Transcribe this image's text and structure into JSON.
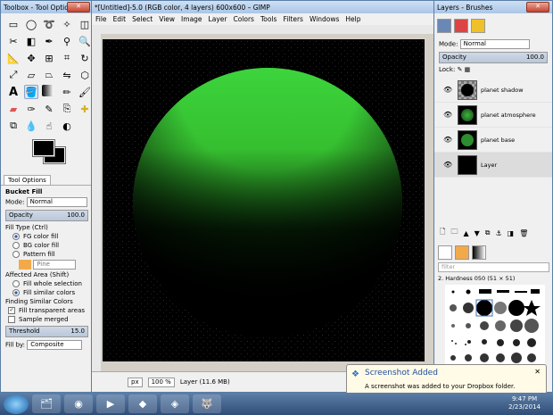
{
  "toolbox": {
    "title": "Toolbox - Tool Options",
    "tab_label": "Tool Options",
    "tool_name": "Bucket Fill",
    "mode_label": "Mode:",
    "mode_value": "Normal",
    "opacity_label": "Opacity",
    "opacity_value": "100.0",
    "fill_type_label": "Fill Type  (Ctrl)",
    "fill_fg": "FG color fill",
    "fill_bg": "BG color fill",
    "fill_pattern": "Pattern fill",
    "pattern_name": "Pine",
    "affected_label": "Affected Area  (Shift)",
    "fill_whole": "Fill whole selection",
    "fill_similar": "Fill similar colors",
    "finding_label": "Finding Similar Colors",
    "fill_transparent": "Fill transparent areas",
    "sample_merged": "Sample merged",
    "threshold_label": "Threshold",
    "threshold_value": "15.0",
    "fill_by_label": "Fill by:",
    "fill_by_value": "Composite"
  },
  "image_window": {
    "title": "*[Untitled]-5.0 (RGB color, 4 layers) 600x600 – GIMP",
    "menu": [
      "File",
      "Edit",
      "Select",
      "View",
      "Image",
      "Layer",
      "Colors",
      "Tools",
      "Filters",
      "Windows",
      "Help"
    ],
    "unit": "px",
    "zoom": "100 %",
    "status": "Layer (11.6 MB)"
  },
  "layers_panel": {
    "title": "Layers - Brushes",
    "mode_label": "Mode:",
    "mode_value": "Normal",
    "opacity_label": "Opacity",
    "opacity_value": "100.0",
    "lock_label": "Lock:",
    "layers": [
      {
        "name": "planet shadow"
      },
      {
        "name": "planet atmosphere"
      },
      {
        "name": "planet base"
      },
      {
        "name": "Layer"
      }
    ],
    "filter_placeholder": "filter",
    "brush_name": "2. Hardness 050 (51 × 51)"
  },
  "notification": {
    "title": "Screenshot Added",
    "message": "A screenshot was added to your Dropbox folder."
  },
  "taskbar": {
    "time": "9:47 PM",
    "date": "2/23/2014"
  },
  "colors": {
    "planet_green": "#3cd43c",
    "canvas_bg": "#000000"
  }
}
